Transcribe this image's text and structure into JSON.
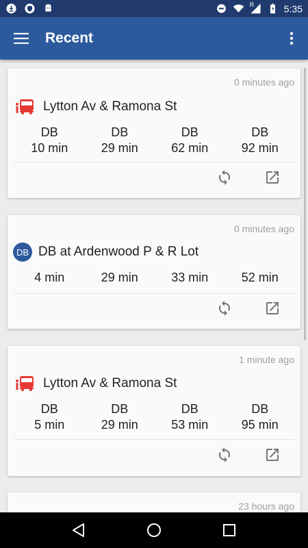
{
  "status_bar": {
    "time": "5:35",
    "left_icons": [
      "download-icon",
      "shield-icon",
      "android-icon"
    ],
    "right_icons": [
      "do-not-disturb-icon",
      "wifi-icon",
      "signal-icon",
      "battery-icon"
    ],
    "signal_label": "R"
  },
  "app_bar": {
    "title": "Recent",
    "menu_icon": "hamburger-menu-icon",
    "more_icon": "more-vert-icon"
  },
  "cards": [
    {
      "time_ago": "0 minutes ago",
      "type": "stop",
      "title": "Lytton Av & Ramona St",
      "predictions": [
        {
          "route": "DB",
          "time": "10 min"
        },
        {
          "route": "DB",
          "time": "29 min"
        },
        {
          "route": "DB",
          "time": "62 min"
        },
        {
          "route": "DB",
          "time": "92 min"
        }
      ]
    },
    {
      "time_ago": "0 minutes ago",
      "type": "route",
      "badge": "DB",
      "title": "DB at Ardenwood P & R Lot",
      "predictions": [
        {
          "time": "4 min"
        },
        {
          "time": "29 min"
        },
        {
          "time": "33 min"
        },
        {
          "time": "52 min"
        }
      ]
    },
    {
      "time_ago": "1 minute ago",
      "type": "stop",
      "title": "Lytton Av & Ramona St",
      "predictions": [
        {
          "route": "DB",
          "time": "5 min"
        },
        {
          "route": "DB",
          "time": "29 min"
        },
        {
          "route": "DB",
          "time": "53 min"
        },
        {
          "route": "DB",
          "time": "95 min"
        }
      ]
    },
    {
      "time_ago": "23 hours ago"
    }
  ],
  "colors": {
    "status_bar": "#203a6e",
    "app_bar": "#2d5a9e",
    "bus_icon": "#e53935",
    "badge": "#2d5a9e"
  }
}
